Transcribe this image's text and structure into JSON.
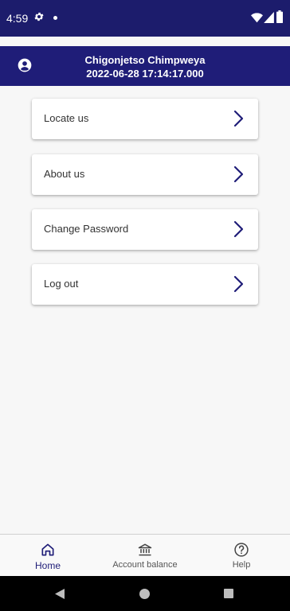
{
  "status_bar": {
    "time": "4:59"
  },
  "header": {
    "user_name": "Chigonjetso Chimpweya",
    "timestamp": "2022-06-28 17:14:17.000",
    "icon": "account-circle-icon"
  },
  "menu": {
    "items": [
      {
        "label": "Locate us",
        "icon": "chevron-right-icon"
      },
      {
        "label": "About us",
        "icon": "chevron-right-icon"
      },
      {
        "label": "Change Password",
        "icon": "chevron-right-icon"
      },
      {
        "label": "Log out",
        "icon": "chevron-right-icon"
      }
    ]
  },
  "bottom_nav": {
    "items": [
      {
        "label": "Home",
        "icon": "home-icon",
        "active": true
      },
      {
        "label": "Account balance",
        "icon": "bank-icon",
        "active": false
      },
      {
        "label": "Help",
        "icon": "help-circle-icon",
        "active": false
      }
    ]
  },
  "colors": {
    "primary": "#1f1d78",
    "status_bar": "#1c1c6c",
    "background": "#f7f7f7"
  }
}
